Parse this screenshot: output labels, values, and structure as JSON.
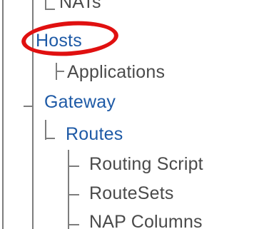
{
  "tree": {
    "items": [
      {
        "label": "NATs"
      },
      {
        "label": "Hosts"
      },
      {
        "label": "Applications"
      },
      {
        "label": "Gateway"
      },
      {
        "label": "Routes"
      },
      {
        "label": "Routing Script"
      },
      {
        "label": "RouteSets"
      },
      {
        "label": "NAP Columns"
      }
    ]
  },
  "colors": {
    "link": "#1e5aa6",
    "plain_text": "#4a4a4a",
    "tree_lines": "#7d7d7d",
    "highlight": "#e01010"
  }
}
